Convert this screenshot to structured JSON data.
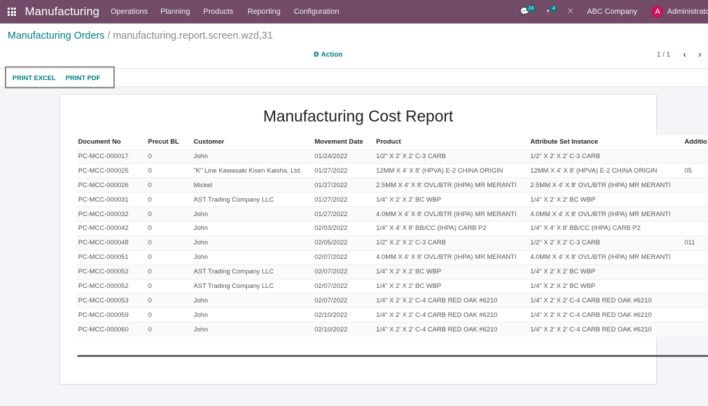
{
  "navbar": {
    "app_title": "Manufacturing",
    "menu": [
      "Operations",
      "Planning",
      "Products",
      "Reporting",
      "Configuration"
    ],
    "messages_count": "24",
    "activities_count": "4",
    "company": "ABC Company",
    "avatar_letter": "A",
    "user": "Administrator",
    "brand_color": "#714b67"
  },
  "breadcrumb": {
    "parent": "Manufacturing Orders",
    "separator": " / ",
    "current": "manufacturing.report.screen.wzd,31"
  },
  "control": {
    "action_label": "Action",
    "pager": "1 / 1"
  },
  "buttons": {
    "print_excel": "PRINT EXCEL",
    "print_pdf": "PRINT PDF"
  },
  "report": {
    "title": "Manufacturing Cost Report",
    "columns": [
      "Document No",
      "Precut BL",
      "Customer",
      "Movement Date",
      "Product",
      "Attribute Set Instance",
      "Additio"
    ],
    "rows": [
      [
        "PC-MCC-000017",
        "0",
        "John",
        "01/24/2022",
        "1/2\" X 2' X 2' C-3 CARB",
        "1/2\" X 2' X 2' C-3 CARB",
        ""
      ],
      [
        "PC-MCC-000025",
        "0",
        "\"K\" Line Kawasaki Kisen Kaisha, Ltd.",
        "01/27/2022",
        "12MM X 4' X 8' (HPVA) E-2 CHINA ORIGIN",
        "12MM X 4' X 8' (HPVA) E-2 CHINA ORIGIN",
        "05"
      ],
      [
        "PC-MCC-000026",
        "0",
        "Mickel",
        "01/27/2022",
        "2.5MM X 4' X 8' OVL/BTR (IHPA) MR MERANTI",
        "2.5MM X 4' X 8' OVL/BTR (IHPA) MR MERANTI",
        ""
      ],
      [
        "PC-MCC-000031",
        "0",
        "AST Trading Company LLC",
        "01/27/2022",
        "1/4\" X 2' X 2' BC WBP",
        "1/4\" X 2' X 2' BC WBP",
        ""
      ],
      [
        "PC-MCC-000032",
        "0",
        "John",
        "01/27/2022",
        "4.0MM X 4' X 8' OVL/BTR (IHPA) MR MERANTI",
        "4.0MM X 4' X 8' OVL/BTR (IHPA) MR MERANTI",
        ""
      ],
      [
        "PC-MCC-000042",
        "0",
        "John",
        "02/03/2022",
        "1/4\" X 4' X 8' BB/CC (IHPA) CARB P2",
        "1/4\" X 4' X 8' BB/CC (IHPA) CARB P2",
        ""
      ],
      [
        "PC-MCC-000048",
        "0",
        "John",
        "02/05/2022",
        "1/2\" X 2' X 2' C-3 CARB",
        "1/2\" X 2' X 2' C-3 CARB",
        "011"
      ],
      [
        "PC-MCC-000051",
        "0",
        "John",
        "02/07/2022",
        "4.0MM X 4' X 8' OVL/BTR (IHPA) MR MERANTI",
        "4.0MM X 4' X 8' OVL/BTR (IHPA) MR MERANTI",
        ""
      ],
      [
        "PC-MCC-000052",
        "0",
        "AST Trading Company LLC",
        "02/07/2022",
        "1/4\" X 2' X 2' BC WBP",
        "1/4\" X 2' X 2' BC WBP",
        ""
      ],
      [
        "PC-MCC-000052",
        "0",
        "AST Trading Company LLC",
        "02/07/2022",
        "1/4\" X 2' X 2' BC WBP",
        "1/4\" X 2' X 2' BC WBP",
        ""
      ],
      [
        "PC-MCC-000053",
        "0",
        "John",
        "02/07/2022",
        "1/4\" X 2' X 2' C-4 CARB RED OAK #6210",
        "1/4\" X 2' X 2' C-4 CARB RED OAK #6210",
        ""
      ],
      [
        "PC-MCC-000059",
        "0",
        "John",
        "02/10/2022",
        "1/4\" X 2' X 2' C-4 CARB RED OAK #6210",
        "1/4\" X 2' X 2' C-4 CARB RED OAK #6210",
        ""
      ],
      [
        "PC-MCC-000060",
        "0",
        "John",
        "02/10/2022",
        "1/4\" X 2' X 2' C-4 CARB RED OAK #6210",
        "1/4\" X 2' X 2' C-4 CARB RED OAK #6210",
        ""
      ]
    ]
  }
}
